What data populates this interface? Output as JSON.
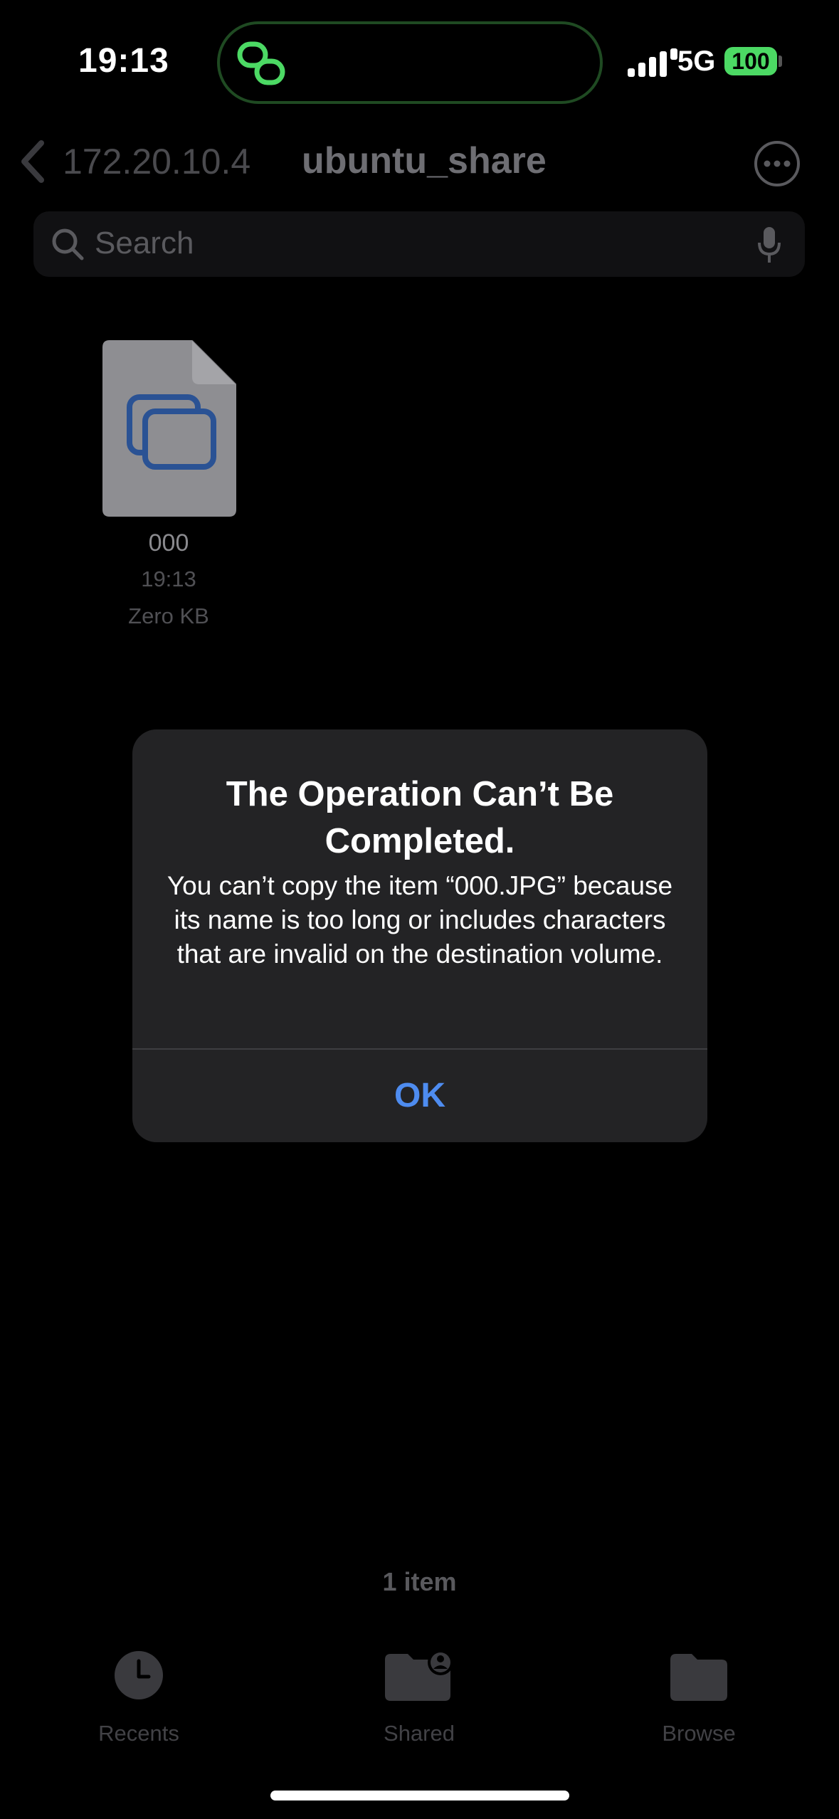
{
  "status_bar": {
    "time": "19:13",
    "network": "5G",
    "battery": "100",
    "island_icon": "link-icon",
    "island_accent": "#4cd964"
  },
  "nav": {
    "back_label": "172.20.10.4",
    "title": "ubuntu_share",
    "more_icon": "ellipsis-circle-icon"
  },
  "search": {
    "placeholder": "Search",
    "icon": "search-icon",
    "mic_icon": "microphone-icon"
  },
  "files": [
    {
      "name": "000",
      "time": "19:13",
      "size": "Zero KB",
      "icon": "photo-file-icon"
    }
  ],
  "alert": {
    "title": "The Operation Can’t Be Completed.",
    "message": "You can’t copy the item “000.JPG” because its name is too long or includes characters that are invalid on the destination volume.",
    "ok_label": "OK",
    "accent": "#4e8cf0"
  },
  "footer": {
    "item_count": "1 item"
  },
  "tabs": [
    {
      "label": "Recents",
      "icon": "clock-icon"
    },
    {
      "label": "Shared",
      "icon": "shared-folder-icon"
    },
    {
      "label": "Browse",
      "icon": "folder-icon"
    }
  ]
}
